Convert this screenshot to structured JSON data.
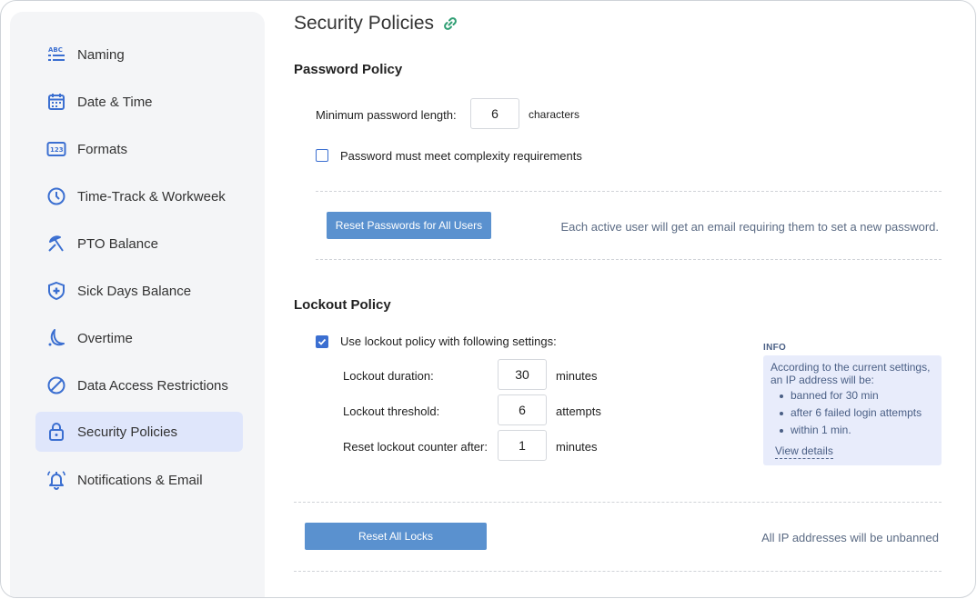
{
  "sidebar": {
    "items": [
      {
        "label": "Naming",
        "icon": "abc-list-icon"
      },
      {
        "label": "Date & Time",
        "icon": "calendar-icon"
      },
      {
        "label": "Formats",
        "icon": "number-format-icon"
      },
      {
        "label": "Time-Track & Workweek",
        "icon": "clock-icon"
      },
      {
        "label": "PTO Balance",
        "icon": "beach-umbrella-icon"
      },
      {
        "label": "Sick Days Balance",
        "icon": "medical-shield-icon"
      },
      {
        "label": "Overtime",
        "icon": "moon-icon"
      },
      {
        "label": "Data Access Restrictions",
        "icon": "prohibited-icon"
      },
      {
        "label": "Security Policies",
        "icon": "lock-icon",
        "active": true
      },
      {
        "label": "Notifications & Email",
        "icon": "bell-icon"
      }
    ]
  },
  "page": {
    "title": "Security Policies",
    "link_icon": "link-icon"
  },
  "password_policy": {
    "title": "Password Policy",
    "min_length_label": "Minimum password length:",
    "min_length_value": "6",
    "min_length_unit": "characters",
    "complexity_label": "Password must meet complexity requirements",
    "complexity_checked": false,
    "reset_button": "Reset Passwords for All Users",
    "reset_note": "Each active user will get an email requiring them to set a new password."
  },
  "lockout_policy": {
    "title": "Lockout Policy",
    "use_label": "Use lockout policy with following settings:",
    "use_checked": true,
    "duration_label": "Lockout duration:",
    "duration_value": "30",
    "duration_unit": "minutes",
    "threshold_label": "Lockout threshold:",
    "threshold_value": "6",
    "threshold_unit": "attempts",
    "reset_counter_label": "Reset lockout counter after:",
    "reset_counter_value": "1",
    "reset_counter_unit": "minutes",
    "reset_locks_button": "Reset All Locks",
    "reset_locks_note": "All IP addresses will be unbanned"
  },
  "info": {
    "heading": "INFO",
    "intro": "According to the current settings, an IP address will be:",
    "bullets": [
      "banned for 30 min",
      "after 6 failed login attempts",
      "within 1 min."
    ],
    "link": "View details"
  },
  "colors": {
    "accent": "#3b6fd1",
    "button": "#5a91cf",
    "active_nav": "#dfe6fb",
    "info_bg": "#e8ecfb",
    "link_icon": "#2f9e73"
  }
}
